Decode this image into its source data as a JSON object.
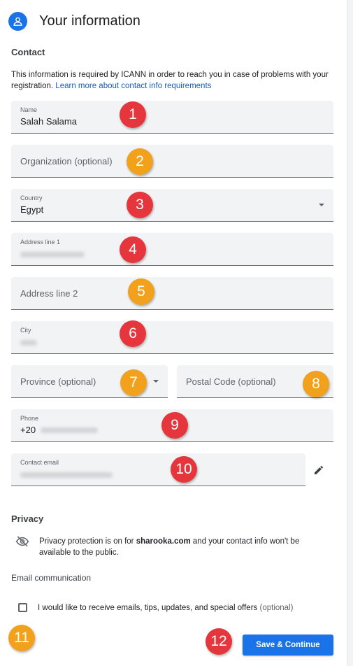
{
  "header": {
    "title": "Your information",
    "icon": "account-icon"
  },
  "contact": {
    "heading": "Contact",
    "note": "This information is required by ICANN in order to reach you in case of problems with your registration.",
    "note_link": "Learn more about contact info requirements"
  },
  "fields": {
    "name": {
      "label": "Name",
      "value": "Salah Salama"
    },
    "organization": {
      "placeholder": "Organization (optional)"
    },
    "country": {
      "label": "Country",
      "value": "Egypt"
    },
    "address1": {
      "label": "Address line 1"
    },
    "address2": {
      "placeholder": "Address line 2"
    },
    "city": {
      "label": "City"
    },
    "province": {
      "placeholder": "Province (optional)"
    },
    "postal": {
      "placeholder": "Postal Code (optional)"
    },
    "phone": {
      "label": "Phone",
      "value": "+20"
    },
    "email": {
      "label": "Contact email"
    }
  },
  "privacy": {
    "heading": "Privacy",
    "text_before": "Privacy protection is on for",
    "domain": "sharooka.com",
    "text_after": "and your contact info won't be available to the public."
  },
  "email_communication": {
    "heading": "Email communication",
    "checkbox_label": "I would like to receive emails, tips, updates, and special offers",
    "optional": "(optional)",
    "checked": false
  },
  "actions": {
    "save_continue": "Save & Continue"
  },
  "markers": [
    "1",
    "2",
    "3",
    "4",
    "5",
    "6",
    "7",
    "8",
    "9",
    "10",
    "11",
    "12"
  ],
  "colors": {
    "accent": "#1a73e8",
    "marker_red": "#e5363d",
    "marker_yellow": "#f2a11d",
    "field_bg": "#f1f3f4"
  }
}
